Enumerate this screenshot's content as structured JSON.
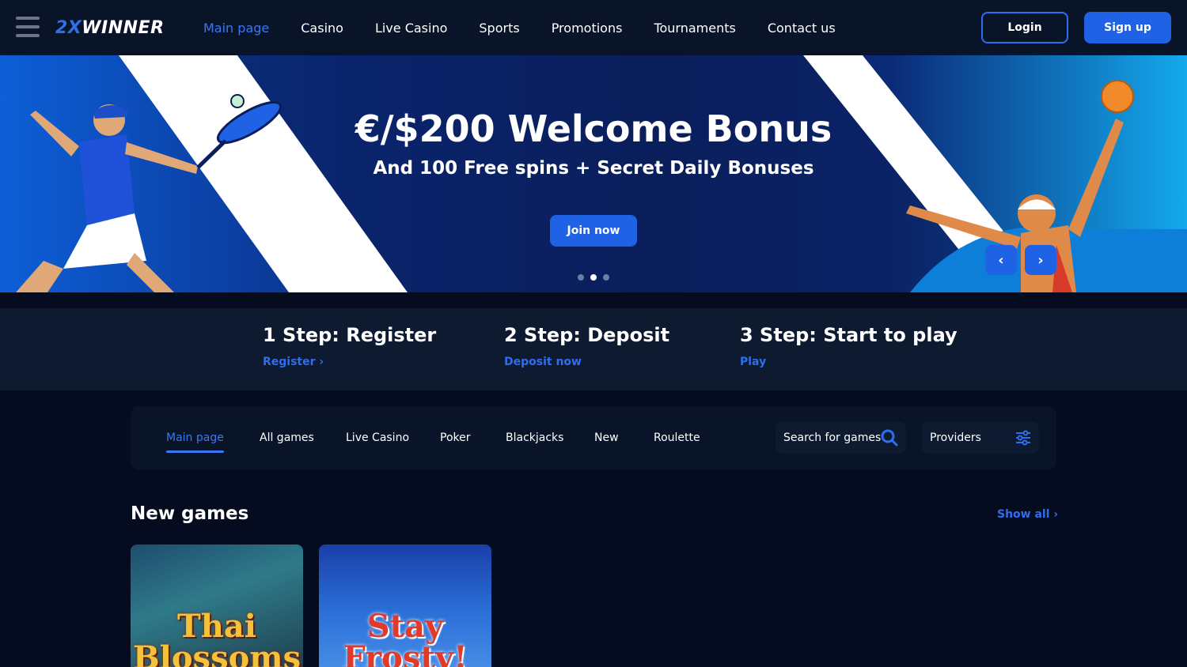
{
  "header": {
    "logo_a": "2X",
    "logo_b": "WINNER",
    "nav": [
      "Main page",
      "Casino",
      "Live Casino",
      "Sports",
      "Promotions",
      "Tournaments",
      "Contact us"
    ],
    "login": "Login",
    "signup": "Sign up"
  },
  "banner": {
    "title": "€/$200 Welcome Bonus",
    "subtitle": "And 100 Free spins + Secret Daily Bonuses",
    "cta": "Join now",
    "prev": "‹",
    "next": "›"
  },
  "steps": [
    {
      "title": "1 Step: Register",
      "link": "Register ›"
    },
    {
      "title": "2 Step: Deposit",
      "link": "Deposit now"
    },
    {
      "title": "3 Step: Start to play",
      "link": "Play"
    }
  ],
  "games_nav": {
    "tabs": [
      "Main page",
      "All games",
      "Live Casino",
      "Poker",
      "Blackjacks",
      "New",
      "Roulette"
    ],
    "search": "Search for games",
    "providers": "Providers"
  },
  "new_games": {
    "title": "New games",
    "show_all": "Show all ›",
    "games": [
      "Thai Blossoms",
      "Stay Frosty!"
    ]
  }
}
